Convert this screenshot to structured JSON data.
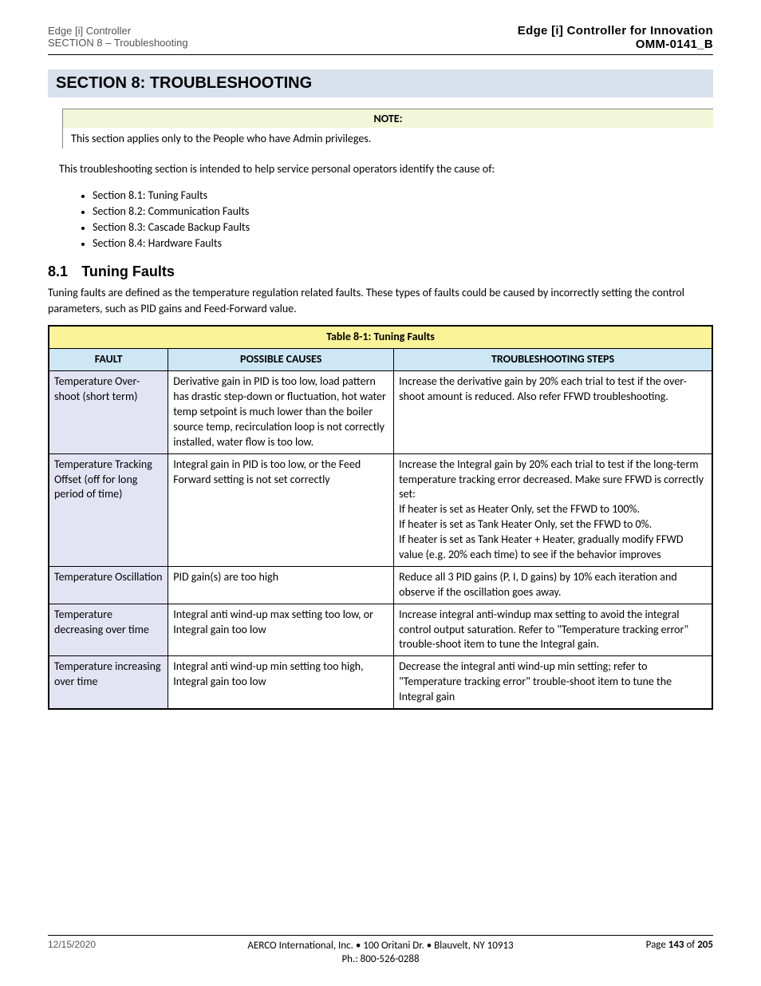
{
  "header": {
    "left_line1": "Edge [i] Controller",
    "left_line2": "SECTION 8 – Troubleshooting",
    "right_line1": "Edge [i] Controller for Innovation",
    "right_line2": "OMM-0141_B"
  },
  "chapter": "SECTION 8:    TROUBLESHOOTING",
  "note": {
    "title": "NOTE:",
    "body": "This section applies only to the People who have Admin privileges."
  },
  "intro": {
    "line1": "This troubleshooting section is intended to help service personal operators identify the cause of:",
    "bullets": [
      "Section 8.1: Tuning Faults",
      "Section 8.2: Communication Faults",
      "Section 8.3: Cascade Backup Faults",
      "Section 8.4: Hardware Faults"
    ]
  },
  "section": {
    "number": "8.1",
    "title": "Tuning Faults",
    "text": "Tuning faults are defined as the temperature regulation related faults. These types of faults could be caused by incorrectly setting the control parameters, such as PID gains and Feed-Forward value."
  },
  "table": {
    "title": "Table 8-1:  Tuning Faults",
    "headers": [
      "FAULT",
      "POSSIBLE CAUSES",
      "TROUBLESHOOTING STEPS"
    ],
    "rows": [
      {
        "fault": "Temperature Over-shoot (short term)",
        "causes": "Derivative gain in PID is too low, load pattern has drastic step-down or fluctuation, hot water temp setpoint is much lower than the boiler source temp, recirculation loop is not correctly installed, water flow is too low.",
        "steps": "Increase the derivative gain by 20% each trial to test if the over-shoot amount is reduced. Also refer FFWD troubleshooting."
      },
      {
        "fault": "Temperature Tracking Offset (off for long period of time)",
        "causes": "Integral gain in PID is too low, or the Feed Forward setting is not set correctly",
        "steps": "Increase the Integral gain by 20% each trial to test if the long-term temperature tracking error decreased. Make sure FFWD is correctly set:\nIf heater is set as Heater Only, set the FFWD to 100%.\nIf heater is set as Tank Heater Only, set the FFWD to 0%.\nIf heater is set as Tank Heater + Heater, gradually modify FFWD value (e.g. 20% each time) to see if the behavior improves"
      },
      {
        "fault": "Temperature Oscillation",
        "causes": "PID gain(s) are too high",
        "steps": "Reduce all 3 PID gains (P, I, D gains) by 10% each iteration and observe if the oscillation goes away."
      },
      {
        "fault": "Temperature decreasing over time",
        "causes": "Integral anti wind-up max setting too low, or Integral gain too low",
        "steps": "Increase integral anti-windup max setting to avoid the integral control output saturation. Refer to \"Temperature tracking error\" trouble-shoot item to tune the Integral gain."
      },
      {
        "fault": "Temperature increasing over time",
        "causes": "Integral anti wind-up min setting too high, Integral gain too low",
        "steps": "Decrease the integral anti wind-up min setting; refer to \"Temperature tracking error\" trouble-shoot item to tune the Integral gain"
      }
    ]
  },
  "footer": {
    "left": "12/15/2020",
    "center_line1": "AERCO International, Inc. • 100 Oritani Dr. • Blauvelt, NY 10913",
    "center_line2": "Ph.: 800-526-0288",
    "right_line1": "Page 143  of  205",
    "right_bold": "143",
    "right_total": "205"
  }
}
